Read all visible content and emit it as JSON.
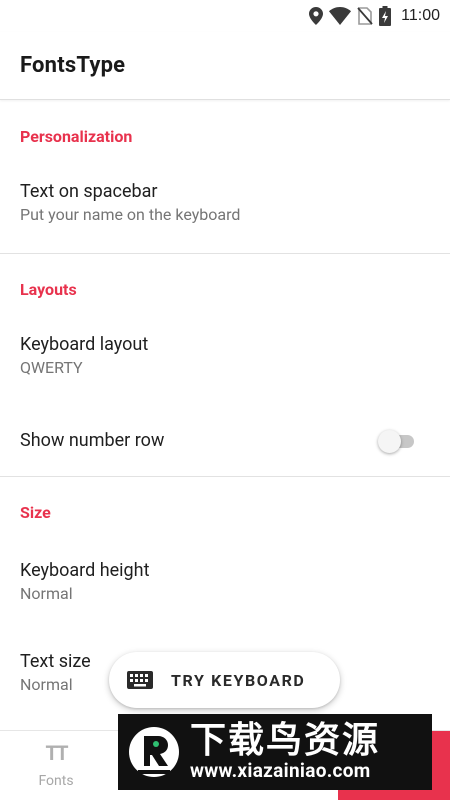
{
  "status_bar": {
    "time": "11:00",
    "icons": [
      "location-icon",
      "wifi-icon",
      "no-sim-icon",
      "battery-charging-icon"
    ]
  },
  "app_bar": {
    "title": "FontsType"
  },
  "sections": [
    {
      "header": "Personalization",
      "items": [
        {
          "title": "Text on spacebar",
          "subtitle": "Put your name on the keyboard"
        }
      ]
    },
    {
      "header": "Layouts",
      "items": [
        {
          "title": "Keyboard layout",
          "subtitle": "QWERTY"
        },
        {
          "title": "Show number row",
          "toggle": false
        }
      ]
    },
    {
      "header": "Size",
      "items": [
        {
          "title": "Keyboard height",
          "subtitle": "Normal"
        },
        {
          "title": "Text size",
          "subtitle": "Normal"
        }
      ]
    }
  ],
  "fab": {
    "label": "TRY KEYBOARD",
    "icon": "keyboard-icon"
  },
  "bottom_nav": {
    "items": [
      {
        "label": "Fonts",
        "icon": "font-size-icon",
        "glyph": "TT"
      }
    ]
  },
  "watermark": {
    "text_cn": "下载鸟资源",
    "url": "www.xiazainiao.com"
  },
  "colors": {
    "accent": "#e8324d",
    "text_primary": "#1f1f1f",
    "text_secondary": "#757575",
    "divider": "#e2e2e2"
  }
}
